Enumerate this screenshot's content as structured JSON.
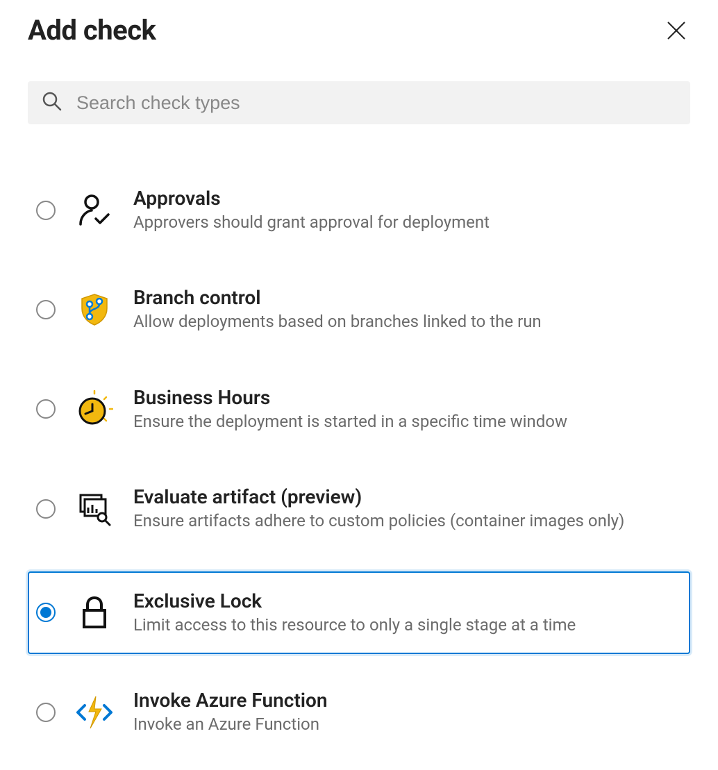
{
  "header": {
    "title": "Add check"
  },
  "search": {
    "placeholder": "Search check types",
    "value": ""
  },
  "check_types": [
    {
      "id": "approvals",
      "title": "Approvals",
      "description": "Approvers should grant approval for deployment",
      "icon": "person-check-icon",
      "selected": false
    },
    {
      "id": "branch-control",
      "title": "Branch control",
      "description": "Allow deployments based on branches linked to the run",
      "icon": "branch-shield-icon",
      "selected": false
    },
    {
      "id": "business-hours",
      "title": "Business Hours",
      "description": "Ensure the deployment is started in a specific time window",
      "icon": "clock-icon",
      "selected": false
    },
    {
      "id": "evaluate-artifact",
      "title": "Evaluate artifact (preview)",
      "description": "Ensure artifacts adhere to custom policies (container images only)",
      "icon": "artifact-icon",
      "selected": false
    },
    {
      "id": "exclusive-lock",
      "title": "Exclusive Lock",
      "description": "Limit access to this resource to only a single stage at a time",
      "icon": "lock-icon",
      "selected": true
    },
    {
      "id": "invoke-azure-function",
      "title": "Invoke Azure Function",
      "description": "Invoke an Azure Function",
      "icon": "azure-function-icon",
      "selected": false
    }
  ]
}
